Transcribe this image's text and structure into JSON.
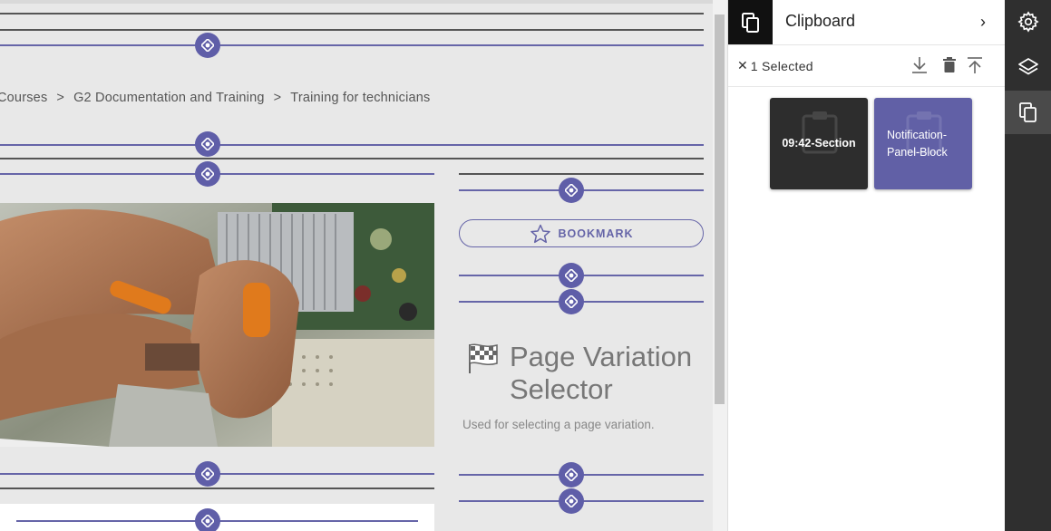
{
  "breadcrumb": {
    "items": [
      "Courses",
      "G2 Documentation and Training",
      "Training for technicians"
    ],
    "separator": ">"
  },
  "bookmark": {
    "label": "BOOKMARK",
    "icon": "star-icon"
  },
  "page_variation": {
    "title_line1": "Page Variation",
    "title_line2": "Selector",
    "description": "Used for selecting a page variation.",
    "icon": "checkered-flag-icon"
  },
  "clipboard": {
    "title": "Clipboard",
    "header_icon": "clipboard-copy-icon",
    "chevron": "›",
    "clear_symbol": "✕",
    "selected_label": "1 Selected",
    "toolbar_icons": [
      "download-icon",
      "trash-icon",
      "upload-icon"
    ],
    "items": [
      {
        "label": "09:42-Section",
        "selected": false,
        "color": "#2d2d2d"
      },
      {
        "label": "Notification-Panel-Block",
        "selected": true,
        "color": "#6160a6"
      }
    ]
  },
  "rail": {
    "buttons": [
      "settings-icon",
      "layers-icon",
      "clipboard-icon"
    ],
    "active": "clipboard-icon"
  },
  "colors": {
    "accent": "#5f5ea8",
    "canvas_bg": "#e8e8e8",
    "rail_bg": "#2f2f2f"
  }
}
